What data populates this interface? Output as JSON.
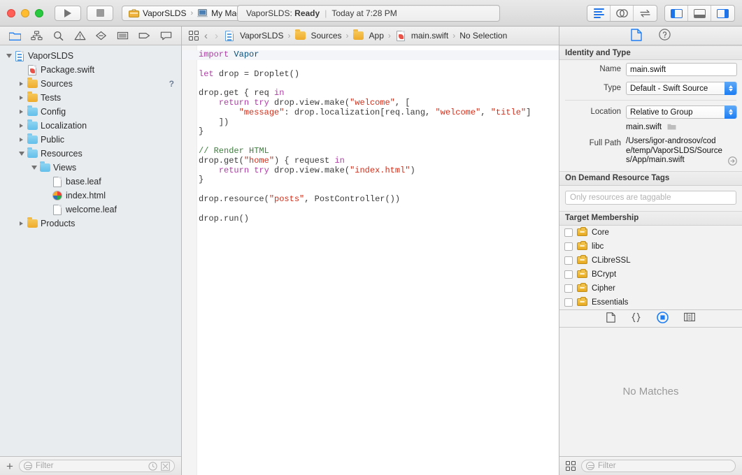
{
  "toolbar": {
    "run_label": "run-button",
    "stop_label": "stop-button",
    "scheme_name": "VaporSLDS",
    "scheme_separator": "›",
    "destination": "My Mac",
    "status_project": "VaporSLDS:",
    "status_state": "Ready",
    "status_divider": "|",
    "status_time": "Today at 7:28 PM"
  },
  "navigator": {
    "tabs": [
      "project-navigator",
      "source-control-navigator",
      "find-navigator",
      "issue-navigator",
      "test-navigator",
      "report-navigator",
      "debug-navigator",
      "breakpoint-navigator"
    ],
    "tree": [
      {
        "label": "VaporSLDS",
        "depth": 0,
        "arrow": "open",
        "icon": "project",
        "badge": ""
      },
      {
        "label": "Package.swift",
        "depth": 1,
        "arrow": "none",
        "icon": "swift",
        "badge": ""
      },
      {
        "label": "Sources",
        "depth": 1,
        "arrow": "closed",
        "icon": "folder-yellow",
        "badge": "?"
      },
      {
        "label": "Tests",
        "depth": 1,
        "arrow": "closed",
        "icon": "folder-yellow",
        "badge": ""
      },
      {
        "label": "Config",
        "depth": 1,
        "arrow": "closed",
        "icon": "folder-blue",
        "badge": ""
      },
      {
        "label": "Localization",
        "depth": 1,
        "arrow": "closed",
        "icon": "folder-blue",
        "badge": ""
      },
      {
        "label": "Public",
        "depth": 1,
        "arrow": "closed",
        "icon": "folder-blue",
        "badge": ""
      },
      {
        "label": "Resources",
        "depth": 1,
        "arrow": "open",
        "icon": "folder-blue",
        "badge": ""
      },
      {
        "label": "Views",
        "depth": 2,
        "arrow": "open",
        "icon": "folder-blue",
        "badge": ""
      },
      {
        "label": "base.leaf",
        "depth": 3,
        "arrow": "none",
        "icon": "doc",
        "badge": ""
      },
      {
        "label": "index.html",
        "depth": 3,
        "arrow": "none",
        "icon": "globe",
        "badge": ""
      },
      {
        "label": "welcome.leaf",
        "depth": 3,
        "arrow": "none",
        "icon": "doc",
        "badge": ""
      },
      {
        "label": "Products",
        "depth": 1,
        "arrow": "closed",
        "icon": "folder-yellow",
        "badge": ""
      }
    ],
    "filter_placeholder": "Filter",
    "add_label": "+"
  },
  "editor": {
    "breadcrumb": [
      {
        "label": "VaporSLDS",
        "icon": "project"
      },
      {
        "label": "Sources",
        "icon": "folder-yellow"
      },
      {
        "label": "App",
        "icon": "folder-yellow"
      },
      {
        "label": "main.swift",
        "icon": "swift"
      },
      {
        "label": "No Selection",
        "icon": "none"
      }
    ],
    "separator": "›",
    "code_lines": [
      [
        {
          "t": "import ",
          "c": "kw"
        },
        {
          "t": "Vapor",
          "c": "pl"
        }
      ],
      [],
      [
        {
          "t": "let ",
          "c": "kw"
        },
        {
          "t": "drop = Droplet()",
          "c": "tp"
        }
      ],
      [],
      [
        {
          "t": "drop.get { req ",
          "c": "tp"
        },
        {
          "t": "in",
          "c": "kw"
        }
      ],
      [
        {
          "t": "    ",
          "c": "tp"
        },
        {
          "t": "return try ",
          "c": "kw"
        },
        {
          "t": "drop.view.make(",
          "c": "tp"
        },
        {
          "t": "\"welcome\"",
          "c": "str"
        },
        {
          "t": ", [",
          "c": "tp"
        }
      ],
      [
        {
          "t": "        ",
          "c": "tp"
        },
        {
          "t": "\"message\"",
          "c": "str"
        },
        {
          "t": ": drop.localization[req.lang, ",
          "c": "tp"
        },
        {
          "t": "\"welcome\"",
          "c": "str"
        },
        {
          "t": ", ",
          "c": "tp"
        },
        {
          "t": "\"title\"",
          "c": "str"
        },
        {
          "t": "]",
          "c": "tp"
        }
      ],
      [
        {
          "t": "    ])",
          "c": "tp"
        }
      ],
      [
        {
          "t": "}",
          "c": "tp"
        }
      ],
      [],
      [
        {
          "t": "// Render HTML",
          "c": "cmt"
        }
      ],
      [
        {
          "t": "drop.get(",
          "c": "tp"
        },
        {
          "t": "\"home\"",
          "c": "str"
        },
        {
          "t": ") { request ",
          "c": "tp"
        },
        {
          "t": "in",
          "c": "kw"
        }
      ],
      [
        {
          "t": "    ",
          "c": "tp"
        },
        {
          "t": "return try ",
          "c": "kw"
        },
        {
          "t": "drop.view.make(",
          "c": "tp"
        },
        {
          "t": "\"index.html\"",
          "c": "str"
        },
        {
          "t": ")",
          "c": "tp"
        }
      ],
      [
        {
          "t": "}",
          "c": "tp"
        }
      ],
      [],
      [
        {
          "t": "drop.resource(",
          "c": "tp"
        },
        {
          "t": "\"posts\"",
          "c": "str"
        },
        {
          "t": ", PostController())",
          "c": "tp"
        }
      ],
      [],
      [
        {
          "t": "drop.run()",
          "c": "tp"
        }
      ]
    ]
  },
  "inspector": {
    "tabs": [
      "file-inspector",
      "quick-help-inspector"
    ],
    "identity_section": "Identity and Type",
    "name_label": "Name",
    "name_value": "main.swift",
    "type_label": "Type",
    "type_value": "Default - Swift Source",
    "location_label": "Location",
    "location_value": "Relative to Group",
    "location_file": "main.swift",
    "fullpath_label": "Full Path",
    "fullpath_value": "/Users/igor-androsov/code/temp/VaporSLDS/Sources/App/main.swift",
    "odt_section": "On Demand Resource Tags",
    "odt_placeholder": "Only resources are taggable",
    "target_section": "Target Membership",
    "targets": [
      {
        "name": "Core",
        "checked": false
      },
      {
        "name": "libc",
        "checked": false
      },
      {
        "name": "CLibreSSL",
        "checked": false
      },
      {
        "name": "BCrypt",
        "checked": false
      },
      {
        "name": "Cipher",
        "checked": false
      },
      {
        "name": "Essentials",
        "checked": false
      }
    ],
    "library_tabs": [
      "file-template-library",
      "code-snippet-library",
      "object-library",
      "media-library"
    ],
    "library_empty": "No Matches",
    "filter_placeholder": "Filter"
  },
  "colors": {
    "accent": "#1d7df3",
    "keyword": "#ad3da4",
    "string": "#d12f1b",
    "comment": "#3f7f3f",
    "folder_yellow": "#eeab2a",
    "folder_blue": "#62bfea"
  }
}
